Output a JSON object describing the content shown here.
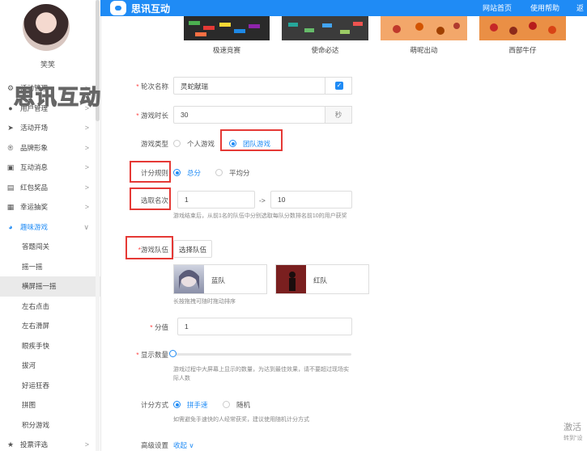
{
  "user": {
    "name": "笑笑"
  },
  "watermark": "思讯互动",
  "header": {
    "brand": "思讯互动",
    "nav": [
      "网站首页",
      "使用帮助",
      "返"
    ]
  },
  "sidebar": {
    "items": [
      {
        "label": "活动管理",
        "icon": "gear-icon",
        "chevron": ">"
      },
      {
        "label": "用户管理",
        "icon": "user-icon",
        "chevron": ">"
      },
      {
        "label": "活动开场",
        "icon": "send-icon",
        "chevron": ">"
      },
      {
        "label": "品牌形象",
        "icon": "brand-icon",
        "chevron": ">"
      },
      {
        "label": "互动消息",
        "icon": "message-icon",
        "chevron": ">"
      },
      {
        "label": "红包奖品",
        "icon": "gift-icon",
        "chevron": ">"
      },
      {
        "label": "幸运抽奖",
        "icon": "lottery-icon",
        "chevron": ">"
      },
      {
        "label": "趣味游戏",
        "icon": "game-icon",
        "chevron": "∨",
        "active": true
      }
    ],
    "subitems": [
      "答题闯关",
      "摇一摇",
      "横屏摇一摇",
      "左右点击",
      "左右滑屏",
      "眼疾手快",
      "拔河",
      "好运狂吞",
      "拼图",
      "积分游戏"
    ],
    "bottom_item": {
      "label": "投票评选",
      "icon": "star-icon",
      "chevron": ">"
    }
  },
  "games": [
    {
      "name": "极速竞赛",
      "color": "#2b2b2b"
    },
    {
      "name": "使命必达",
      "color": "#3a3a3a"
    },
    {
      "name": "萌呢出动",
      "color": "#f0a060"
    },
    {
      "name": "西部牛仔",
      "color": "#e8883a"
    }
  ],
  "form": {
    "round_name": {
      "label": "轮次名称",
      "value": "灵蛇献瑞"
    },
    "duration": {
      "label": "游戏时长",
      "value": "30",
      "unit": "秒"
    },
    "game_type": {
      "label": "游戏类型",
      "options": [
        "个人游戏",
        "团队游戏"
      ],
      "selected": "团队游戏"
    },
    "score_rule": {
      "label": "计分规则",
      "options": [
        "总分",
        "平均分"
      ],
      "selected": "总分"
    },
    "rank": {
      "label": "选取名次",
      "from": "1",
      "arrow": "->",
      "to": "10",
      "hint": "游戏结束后，从前1名的队伍中分别选取每队分数排名前10的用户获奖"
    },
    "team": {
      "label": "游戏队伍",
      "button": "选择队伍",
      "teams": [
        "蓝队",
        "红队"
      ],
      "hint": "长按拖拽可随时拖动排序"
    },
    "score": {
      "label": "分值",
      "value": "1"
    },
    "display_count": {
      "label": "显示数量",
      "value": 0,
      "hint": "游戏过程中大屏幕上显示的数量，为达到最佳效果，请不要超过现场实际人数"
    },
    "scoring_method": {
      "label": "计分方式",
      "options": [
        "拼手速",
        "随机"
      ],
      "selected": "拼手速",
      "hint": "如需避免手速快的人经常获奖，建议使用随机计分方式"
    },
    "advanced": {
      "label": "高级设置",
      "toggle": "收起"
    }
  },
  "corner_text": {
    "line1": "激活",
    "line2": "转到\"设"
  }
}
